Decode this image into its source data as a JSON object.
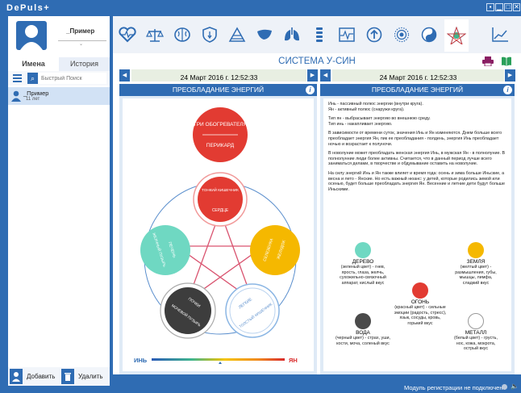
{
  "app": {
    "title": "DePuls+"
  },
  "window_controls": [
    "▪",
    "▁",
    "□",
    "✕"
  ],
  "profile": {
    "name": "_Пример"
  },
  "sidebar": {
    "tabs": [
      {
        "label": "Имена"
      },
      {
        "label": "История"
      }
    ],
    "search_placeholder": "Быстрый Поиск",
    "patients": [
      {
        "name": "_Пример",
        "age": "11 лет"
      }
    ],
    "add_label": "Добавить",
    "delete_label": "Удалить"
  },
  "toolbar_icons": [
    "heart-icon",
    "scales-icon",
    "brain-icon",
    "shield-icon",
    "pyramid-icon",
    "liver-icon",
    "lungs-icon",
    "spine-icon",
    "ecg-chart-icon",
    "upload-circle-icon",
    "sun-circle-icon",
    "yin-yang-icon",
    "pentagram-icon",
    "line-chart-icon"
  ],
  "main": {
    "title": "СИСТЕМА У-СИН",
    "left": {
      "date": "24 Март 2016 г. 12:52:33",
      "header": "ПРЕОБЛАДАНИЕ ЭНЕРГИЙ"
    },
    "right": {
      "date": "24 Март 2016 г. 12:52:33",
      "header": "ПРЕОБЛАДАНИЕ ЭНЕРГИЙ"
    }
  },
  "diagram": {
    "top_top": "ТРИ ОБОГРЕВАТЕЛЯ",
    "top_bottom": "ПЕРИКАРД",
    "fire_top": "ТОНКИЙ КИШЕЧНИК",
    "fire_bottom": "СЕРДЦЕ",
    "earth_a": "ЖЕЛУДОК",
    "earth_b": "СЕЛЕЗЕНКА",
    "wood_a": "ЖЕЛЧНЫЙ ПУЗЫРЬ",
    "wood_b": "ПЕЧЕНЬ",
    "water_a": "ПОЧКИ",
    "water_b": "МОЧЕВОЙ ПУЗЫРЬ",
    "metal_a": "ЛЕГКИЕ",
    "metal_b": "ТОЛСТЫЙ КИШЕЧНИК",
    "yin": "ИНЬ",
    "yang": "ЯН"
  },
  "description": [
    "Инь - пассивный полюс энергии (внутри круга).",
    "Ян - активный полюс (снаружи круга).",
    "Тип ян - выбрасывает энергию во внешнюю среду.",
    "Тип инь - накапливает энергию.",
    "В зависимости от времени суток, значения Инь и Ян изменяются. Днем больше всего преобладает энергия Ян, пик ее преобладания - полдень, энергия Инь преобладает ночью и возрастает к полуночи.",
    "В новолуние может преобладать женская энергия Инь, в мужская Ян - в полнолуние. В полнолунние люди более активны. Считается, что в данный период лучше всего заниматься делами, в творчестве и обдумывание оставить на новолуние.",
    "На силу энергий Инь и Ян также влияет и время года: осень и зима больше Иньские, а весна и лето - Янские. Но есть важный нюанс: у детей, которые родились зимой или осенью, будет больше преобладать энергия Ян. Весенние и летние дети будут больше Иньскими."
  ],
  "elements": [
    {
      "name": "ДЕРЕВО",
      "desc": "(зеленый цвет) - гнев, ярость, глаза, желчь, сухожильно-связочный аппарат, кислый вкус",
      "color": "#6fd8c2"
    },
    {
      "name": "ЗЕМЛЯ",
      "desc": "(желтый цвет) - размышления, губы, мышцы, лимфа, сладкий вкус",
      "color": "#f5b800"
    },
    {
      "name": "ОГОНЬ",
      "desc": "(красный цвет) - сильные эмоции (радость, стресс), язык, сосуды, кровь, горький вкус",
      "color": "#e23b32"
    },
    {
      "name": "ВОДА",
      "desc": "(черный цвет) - страх, уши, кости, моча, соленый вкус",
      "color": "#4a4a4a"
    },
    {
      "name": "МЕТАЛЛ",
      "desc": "(белый цвет) - грусть, нос, кожа, мокрота, острый вкус",
      "color": "#ffffff"
    }
  ],
  "status": {
    "text": "Модуль регистрации не подключен"
  }
}
